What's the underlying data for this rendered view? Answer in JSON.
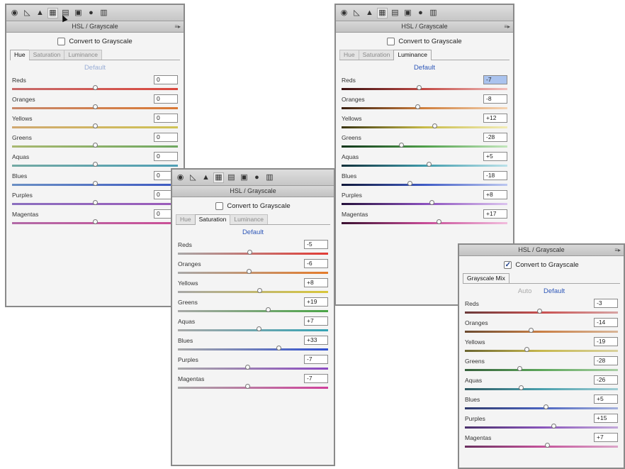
{
  "colors": {
    "link": "#2e57b8",
    "selection": "#aac3ee",
    "panel_bg": "#f4f4f4"
  },
  "toolbar_icons": [
    "basic-icon",
    "tone-curve-icon",
    "detail-icon",
    "hsl-icon",
    "split-toning-icon",
    "lens-icon",
    "effects-icon",
    "calibration-icon"
  ],
  "panels": {
    "hue": {
      "title": "HSL / Grayscale",
      "menu_glyph": "≡▸",
      "convert_label": "Convert to Grayscale",
      "checked": false,
      "tabs": [
        "Hue",
        "Saturation",
        "Luminance"
      ],
      "active_tab": "Hue",
      "default_label": "Default",
      "sliders": [
        {
          "label": "Reds",
          "value": "0"
        },
        {
          "label": "Oranges",
          "value": "0"
        },
        {
          "label": "Yellows",
          "value": "0"
        },
        {
          "label": "Greens",
          "value": "0"
        },
        {
          "label": "Aquas",
          "value": "0"
        },
        {
          "label": "Blues",
          "value": "0"
        },
        {
          "label": "Purples",
          "value": "0"
        },
        {
          "label": "Magentas",
          "value": "0"
        }
      ]
    },
    "saturation": {
      "title": "HSL / Grayscale",
      "convert_label": "Convert to Grayscale",
      "checked": false,
      "tabs": [
        "Hue",
        "Saturation",
        "Luminance"
      ],
      "active_tab": "Saturation",
      "default_label": "Default",
      "sliders": [
        {
          "label": "Reds",
          "value": "-5"
        },
        {
          "label": "Oranges",
          "value": "-6"
        },
        {
          "label": "Yellows",
          "value": "+8"
        },
        {
          "label": "Greens",
          "value": "+19"
        },
        {
          "label": "Aquas",
          "value": "+7"
        },
        {
          "label": "Blues",
          "value": "+33"
        },
        {
          "label": "Purples",
          "value": "-7"
        },
        {
          "label": "Magentas",
          "value": "-7"
        }
      ]
    },
    "luminance": {
      "title": "HSL / Grayscale",
      "menu_glyph": "≡▸",
      "convert_label": "Convert to Grayscale",
      "checked": false,
      "tabs": [
        "Hue",
        "Saturation",
        "Luminance"
      ],
      "active_tab": "Luminance",
      "default_label": "Default",
      "sliders": [
        {
          "label": "Reds",
          "value": "-7"
        },
        {
          "label": "Oranges",
          "value": "-8"
        },
        {
          "label": "Yellows",
          "value": "+12"
        },
        {
          "label": "Greens",
          "value": "-28"
        },
        {
          "label": "Aquas",
          "value": "+5"
        },
        {
          "label": "Blues",
          "value": "-18"
        },
        {
          "label": "Purples",
          "value": "+8"
        },
        {
          "label": "Magentas",
          "value": "+17"
        }
      ]
    },
    "grayscale": {
      "title": "HSL / Grayscale",
      "menu_glyph": "≡▸",
      "convert_label": "Convert to Grayscale",
      "checked": true,
      "tab_label": "Grayscale Mix",
      "auto_label": "Auto",
      "default_label": "Default",
      "sliders": [
        {
          "label": "Reds",
          "value": "-3"
        },
        {
          "label": "Oranges",
          "value": "-14"
        },
        {
          "label": "Yellows",
          "value": "-19"
        },
        {
          "label": "Greens",
          "value": "-28"
        },
        {
          "label": "Aquas",
          "value": "-26"
        },
        {
          "label": "Blues",
          "value": "+5"
        },
        {
          "label": "Purples",
          "value": "+15"
        },
        {
          "label": "Magentas",
          "value": "+7"
        }
      ]
    }
  }
}
